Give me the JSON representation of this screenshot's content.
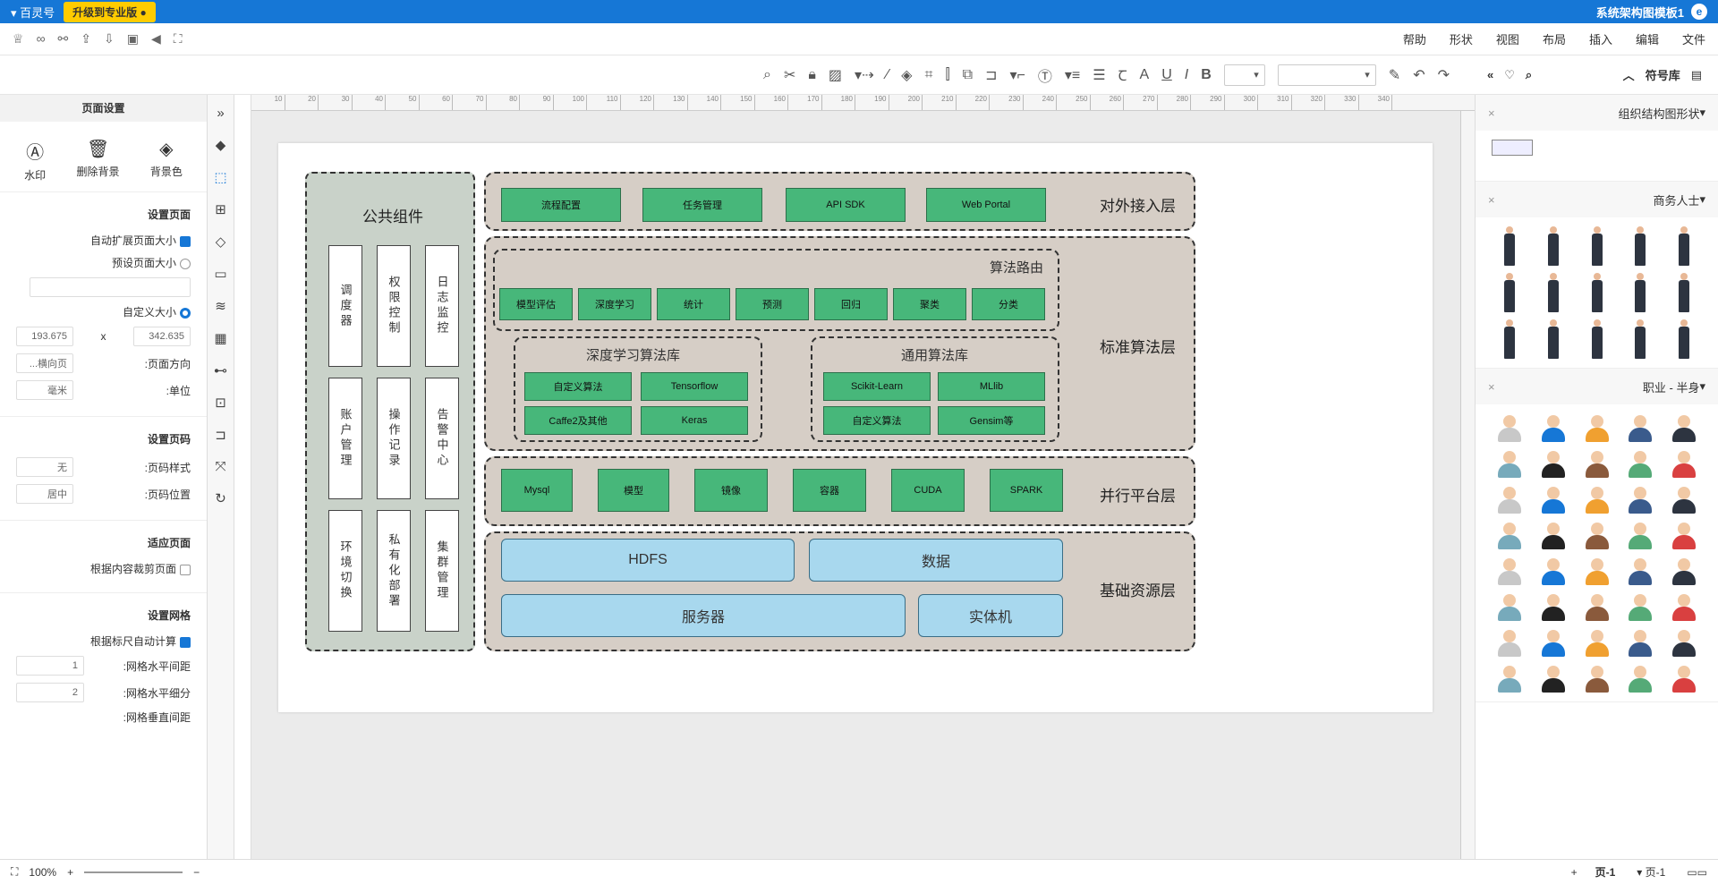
{
  "titlebar": {
    "title": "系统架构图模板1",
    "upgrade": "升级到专业版",
    "team": "百灵号"
  },
  "menu": [
    "文件",
    "编辑",
    "插入",
    "布局",
    "视图",
    "形状",
    "帮助"
  ],
  "library": {
    "title": "符号库",
    "sections": [
      {
        "name": "组织结构图形状",
        "kind": "org"
      },
      {
        "name": "商务人士",
        "kind": "biz"
      },
      {
        "name": "职业 - 半身",
        "kind": "prof"
      }
    ]
  },
  "diagram": {
    "layers": {
      "access": "对外接入层",
      "algo": "标准算法层",
      "parallel": "并行平台层",
      "resource": "基础资源层"
    },
    "access_buttons": [
      "Web Portal",
      "API SDK",
      "任务管理",
      "流程配置"
    ],
    "routing": {
      "title": "算法路由",
      "items": [
        "分类",
        "聚类",
        "回归",
        "预测",
        "统计",
        "深度学习",
        "模型评估"
      ]
    },
    "general_lib": {
      "title": "通用算法库",
      "items": [
        "MLlib",
        "Scikit-Learn",
        "Gensim等",
        "自定义算法"
      ]
    },
    "deep_lib": {
      "title": "深度学习算法库",
      "items": [
        "Tensorflow",
        "自定义算法",
        "Keras",
        "Caffe2及其他"
      ]
    },
    "parallel_buttons": [
      "SPARK",
      "CUDA",
      "容器",
      "镜像",
      "模型",
      "Mysql"
    ],
    "resources": {
      "data": "数据",
      "hdfs": "HDFS",
      "physical": "实体机",
      "server": "服务器"
    },
    "common": {
      "title": "公共组件",
      "cells": [
        "日志监控",
        "权限控制",
        "调度器",
        "告警中心",
        "操作记录",
        "账户管理",
        "集群管理",
        "私有化部署",
        "环境切换"
      ]
    }
  },
  "page_settings": {
    "header": "页面设置",
    "actions": [
      "背景色",
      "删除背景",
      "水印"
    ],
    "set_page": "设置页面",
    "auto_expand": "自动扩展页面大小",
    "preset": "预设页面大小",
    "custom": "自定义大小",
    "width": "342.635",
    "height": "193.675",
    "x": "x",
    "orientation_label": "页面方向:",
    "orientation": "横向页...",
    "unit_label": "单位:",
    "unit": "毫米",
    "pagenum": "设置页码",
    "pn_style_label": "页码样式:",
    "pn_style": "无",
    "pn_pos_label": "页码位置:",
    "pn_pos": "居中",
    "fit": "适应页面",
    "fit_crop": "根据内容裁剪页面",
    "grid": "设置网格",
    "grid_auto": "根据标尺自动计算",
    "grid_h": "网格水平间距:",
    "grid_h_val": "1",
    "grid_hs": "网格水平细分:",
    "grid_hs_val": "2",
    "grid_v": "网格垂直间距:"
  },
  "status": {
    "page": "页-1",
    "page_tab": "页-1",
    "zoom": "100%"
  },
  "ruler": [
    "10",
    "20",
    "30",
    "40",
    "50",
    "60",
    "70",
    "80",
    "90",
    "100",
    "110",
    "120",
    "130",
    "140",
    "150",
    "160",
    "170",
    "180",
    "190",
    "200",
    "210",
    "220",
    "230",
    "240",
    "250",
    "260",
    "270",
    "280",
    "290",
    "300",
    "310",
    "320",
    "330",
    "340"
  ]
}
